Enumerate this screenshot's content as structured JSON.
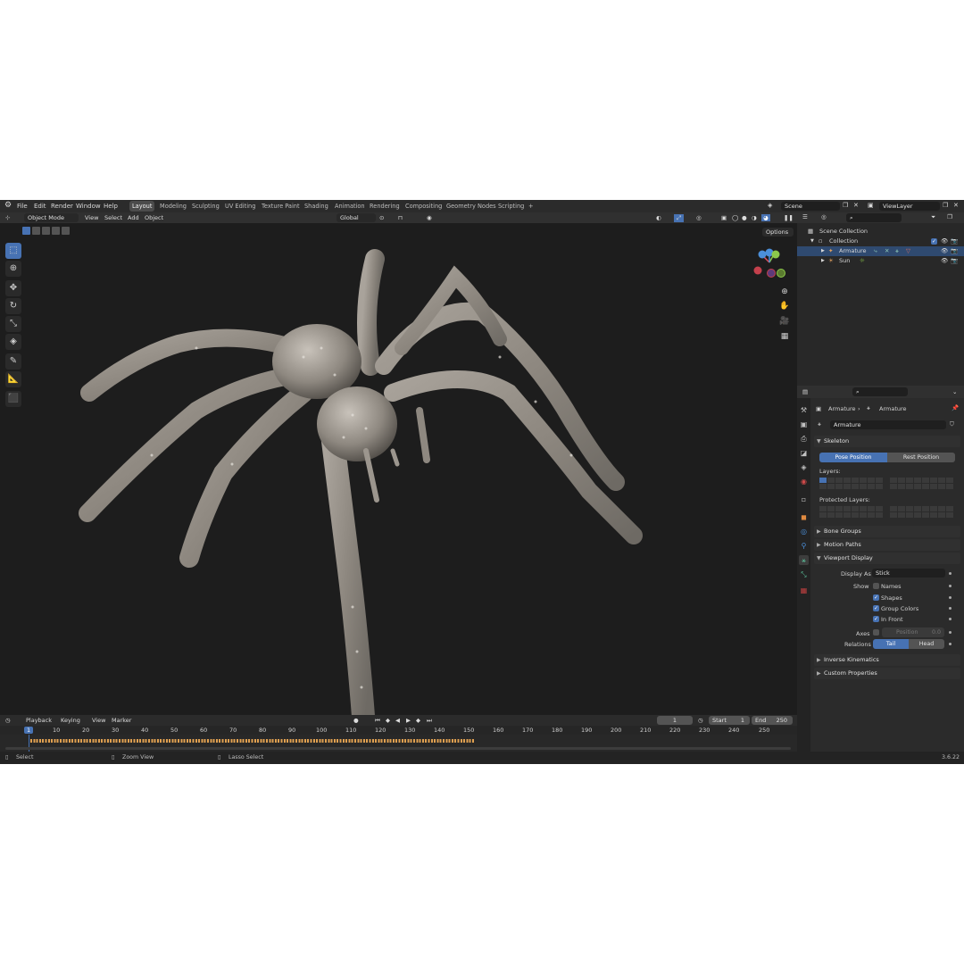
{
  "menubar": {
    "items": [
      "File",
      "Edit",
      "Render",
      "Window",
      "Help"
    ],
    "workspace_tabs": [
      "Layout",
      "Modeling",
      "Sculpting",
      "UV Editing",
      "Texture Paint",
      "Shading",
      "Animation",
      "Rendering",
      "Compositing",
      "Geometry Nodes",
      "Scripting"
    ],
    "active_tab": "Layout",
    "add_tab": "+",
    "scene_label": "Scene",
    "view_layer_label": "ViewLayer"
  },
  "viewport_header": {
    "mode": "Object Mode",
    "menus": [
      "View",
      "Select",
      "Add",
      "Object"
    ],
    "transform_orientation": "Global",
    "options_label": "Options"
  },
  "outliner": {
    "search_placeholder": "",
    "rows": [
      {
        "label": "Scene Collection"
      },
      {
        "label": "Collection"
      },
      {
        "label": "Armature"
      },
      {
        "label": "Sun"
      }
    ]
  },
  "properties": {
    "breadcrumb_object": "Armature",
    "breadcrumb_data": "Armature",
    "data_name": "Armature",
    "skeleton": {
      "title": "Skeleton",
      "pose_position": "Pose Position",
      "rest_position": "Rest Position",
      "layers_label": "Layers:",
      "protected_layers_label": "Protected Layers:"
    },
    "bone_groups": "Bone Groups",
    "motion_paths": "Motion Paths",
    "viewport_display": {
      "title": "Viewport Display",
      "display_as_label": "Display As",
      "display_as_value": "Stick",
      "show_label": "Show",
      "names_label": "Names",
      "names_checked": false,
      "shapes_label": "Shapes",
      "shapes_checked": true,
      "group_colors_label": "Group Colors",
      "group_colors_checked": true,
      "in_front_label": "In Front",
      "in_front_checked": true,
      "axes_label": "Axes",
      "position_label": "Position",
      "position_value": "0.0",
      "relations_label": "Relations",
      "tail_label": "Tail",
      "head_label": "Head"
    },
    "inverse_kinematics": "Inverse Kinematics",
    "custom_properties": "Custom Properties"
  },
  "timeline": {
    "menus": [
      "Playback",
      "Keying",
      "View",
      "Marker"
    ],
    "current_frame": "1",
    "start_label": "Start",
    "start_value": "1",
    "end_label": "End",
    "end_value": "250",
    "ruler_ticks": [
      "1",
      "10",
      "20",
      "30",
      "40",
      "50",
      "60",
      "70",
      "80",
      "90",
      "100",
      "110",
      "120",
      "130",
      "140",
      "150",
      "160",
      "170",
      "180",
      "190",
      "200",
      "210",
      "220",
      "230",
      "240",
      "250"
    ]
  },
  "statusbar": {
    "select": "Select",
    "zoom_view": "Zoom View",
    "lasso_select": "Lasso Select",
    "version": "3.6.22"
  },
  "colors": {
    "accent": "#4772b3",
    "background": "#1d1d1d"
  }
}
